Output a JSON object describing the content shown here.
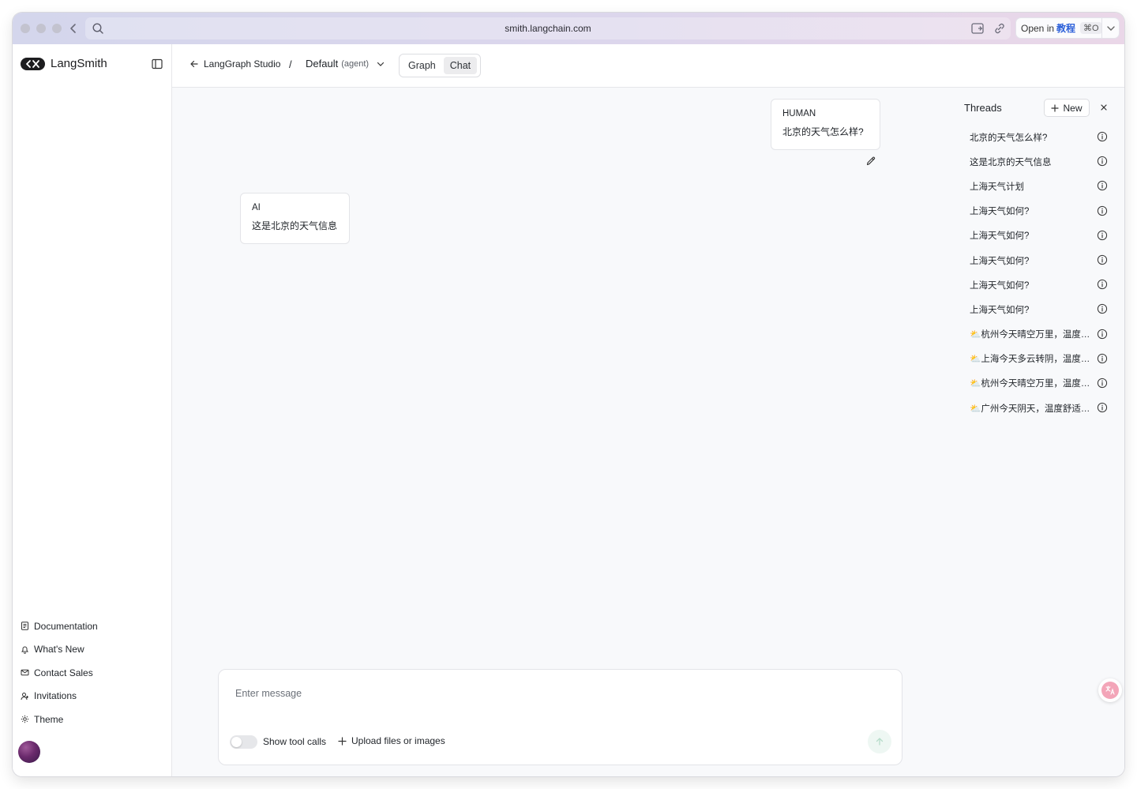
{
  "browser": {
    "url": "smith.langchain.com",
    "open_in": {
      "prefix": "Open in",
      "app": "教程",
      "shortcut": "⌘O"
    }
  },
  "sidebar": {
    "brand": "LangSmith",
    "nav": [
      {
        "label": "Documentation",
        "icon": "document-icon"
      },
      {
        "label": "What's New",
        "icon": "bell-icon"
      },
      {
        "label": "Contact Sales",
        "icon": "mail-icon"
      },
      {
        "label": "Invitations",
        "icon": "user-plus-icon"
      },
      {
        "label": "Theme",
        "icon": "sun-icon"
      }
    ]
  },
  "header": {
    "back_label": "LangGraph Studio",
    "separator": "/",
    "assistant": "Default",
    "assistant_sub": "(agent)",
    "tabs": [
      {
        "label": "Graph",
        "active": false
      },
      {
        "label": "Chat",
        "active": true
      }
    ]
  },
  "chat": {
    "messages": [
      {
        "role": "HUMAN",
        "text": "北京的天气怎么样?"
      },
      {
        "role": "AI",
        "text": "这是北京的天气信息"
      }
    ],
    "composer": {
      "placeholder": "Enter message",
      "toggle_label": "Show tool calls",
      "toggle_on": false,
      "upload_label": "Upload files or images"
    }
  },
  "threads": {
    "title": "Threads",
    "new_label": "New",
    "items": [
      {
        "label": "北京的天气怎么样?"
      },
      {
        "label": "这是北京的天气信息"
      },
      {
        "label": "上海天气计划"
      },
      {
        "label": "上海天气如何?"
      },
      {
        "label": "上海天气如何?"
      },
      {
        "label": "上海天气如何?"
      },
      {
        "label": "上海天气如何?"
      },
      {
        "label": "上海天气如何?"
      },
      {
        "label": "⛅杭州今天晴空万里，温度宜..."
      },
      {
        "label": "⛅上海今天多云转阴，温度稍..."
      },
      {
        "label": "⛅杭州今天晴空万里，温度宜..."
      },
      {
        "label": "⛅广州今天阴天，温度舒适，..."
      }
    ]
  },
  "colors": {
    "sidebar_bg": "#ffffff",
    "content_bg": "#f8f9fb",
    "border": "#e6e7ea",
    "accent_send": "#eef7f3"
  }
}
